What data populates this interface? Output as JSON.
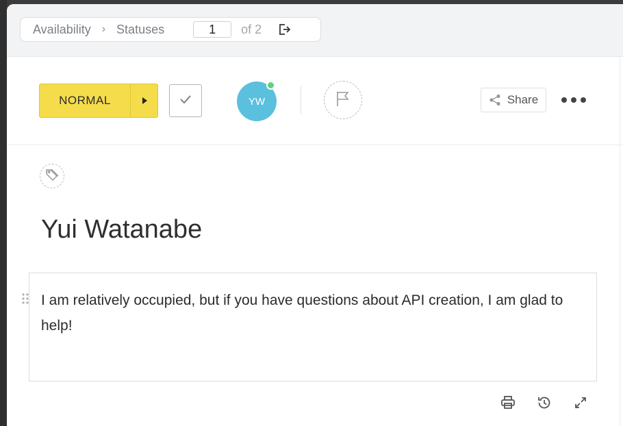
{
  "breadcrumb": {
    "items": [
      "Availability",
      "Statuses"
    ],
    "separator": "›",
    "current_page": "1",
    "total_label": "of 2"
  },
  "toolbar": {
    "status_label": "NORMAL",
    "status_color": "#f4dc4b",
    "assignee_initials": "YW",
    "assignee_color": "#5bc0de",
    "online_color": "#5fd27a",
    "share_label": "Share"
  },
  "record": {
    "title": "Yui Watanabe",
    "description": "I am relatively occupied, but if you have questions about API creation, I am glad to help!"
  },
  "icons": {
    "export": "export-icon",
    "status_arrow": "caret-right-icon",
    "check": "check-icon",
    "flag": "flag-icon",
    "share": "share-icon",
    "more": "more-dots-icon",
    "tag": "tag-icon",
    "drag": "drag-handle-icon",
    "print": "print-icon",
    "history": "history-icon",
    "expand": "expand-icon"
  }
}
